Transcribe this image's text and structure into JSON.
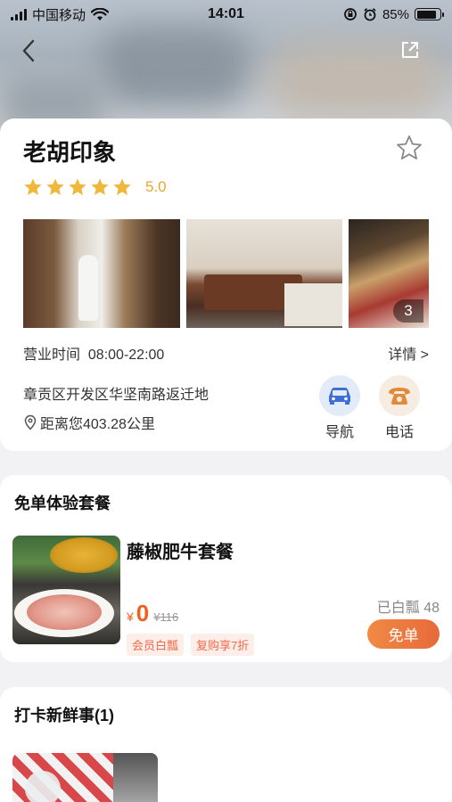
{
  "status_bar": {
    "carrier": "中国移动",
    "time": "14:01",
    "battery": "85%"
  },
  "store": {
    "name": "老胡印象",
    "rating": "5.0",
    "stars": 5,
    "photo_count": "3",
    "hours_label": "营业时间",
    "hours": "08:00-22:00",
    "detail_link": "详情 >",
    "address": "章贡区开发区华坚南路返迁地",
    "distance": "距离您403.28公里",
    "nav_label": "导航",
    "call_label": "电话"
  },
  "free_package": {
    "section_title": "免单体验套餐",
    "name": "藤椒肥牛套餐",
    "currency": "¥",
    "price": "0",
    "original_price": "¥116",
    "claimed": "已白瓢 48",
    "tags": [
      "会员白瓢",
      "复购享7折"
    ],
    "button_label": "免单"
  },
  "checkin": {
    "section_title": "打卡新鲜事(1)"
  },
  "colors": {
    "accent_orange": "#f0611f",
    "star_gold": "#f0b83a",
    "nav_blue": "#3d6fd6",
    "call_orange": "#e08a3a"
  }
}
